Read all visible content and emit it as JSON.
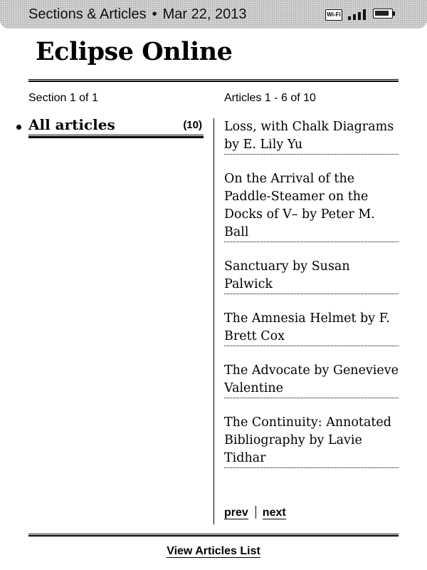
{
  "status_bar": {
    "title": "Sections & Articles",
    "separator": "•",
    "date": "Mar 22, 2013",
    "wifi_label": "Wi-Fi",
    "icons": [
      "wifi-icon",
      "signal-icon",
      "battery-icon"
    ],
    "signal_bars": 4,
    "battery_level": 0.9
  },
  "page": {
    "title": "Eclipse Online"
  },
  "sections": {
    "counter": "Section 1 of 1",
    "items": [
      {
        "label": "All articles",
        "count": "(10)"
      }
    ]
  },
  "articles": {
    "counter": "Articles 1 - 6 of 10",
    "items": [
      {
        "title": "Loss, with Chalk Diagrams by E. Lily Yu"
      },
      {
        "title": "On the Arrival of the Paddle-Steamer on the Docks of V– by Peter M. Ball"
      },
      {
        "title": "Sanctuary by Susan Palwick"
      },
      {
        "title": "The Amnesia Helmet by F. Brett Cox"
      },
      {
        "title": "The Advocate by Genevieve Valentine"
      },
      {
        "title": "The Continuity: Annotated Bibliography by Lavie Tidhar"
      }
    ]
  },
  "pager": {
    "prev_label": "prev",
    "next_label": "next"
  },
  "footer": {
    "view_list_label": "View Articles List"
  }
}
